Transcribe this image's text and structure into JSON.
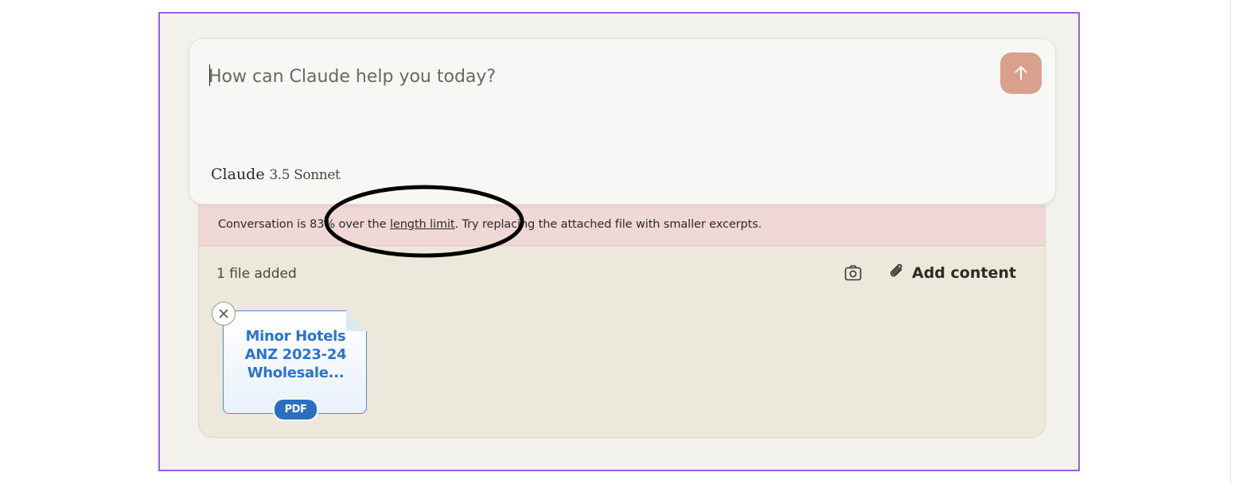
{
  "composer": {
    "placeholder": "How can Claude help you today?",
    "send_icon": "arrow-up-icon",
    "model_brand": "Claude",
    "model_version": "3.5 Sonnet"
  },
  "warning": {
    "text_before": "Conversation is 83% over the ",
    "link_text": "length limit",
    "text_after": ". Try replacing the attached file with smaller excerpts.",
    "over_limit_percent": 83
  },
  "attachments": {
    "count_label": "1 file added",
    "camera_icon": "camera-icon",
    "add_content_icon": "paperclip-icon",
    "add_content_label": "Add content",
    "files": [
      {
        "name": "Minor Hotels ANZ 2023-24 Wholesale...",
        "type_badge": "PDF",
        "remove_icon": "close-icon"
      }
    ]
  },
  "colors": {
    "frame_border": "#9b5de5",
    "warning_bg": "#f0d8d6",
    "send_button": "#d9a08d",
    "file_accent": "#2d74c8",
    "annotation": "#000000"
  }
}
